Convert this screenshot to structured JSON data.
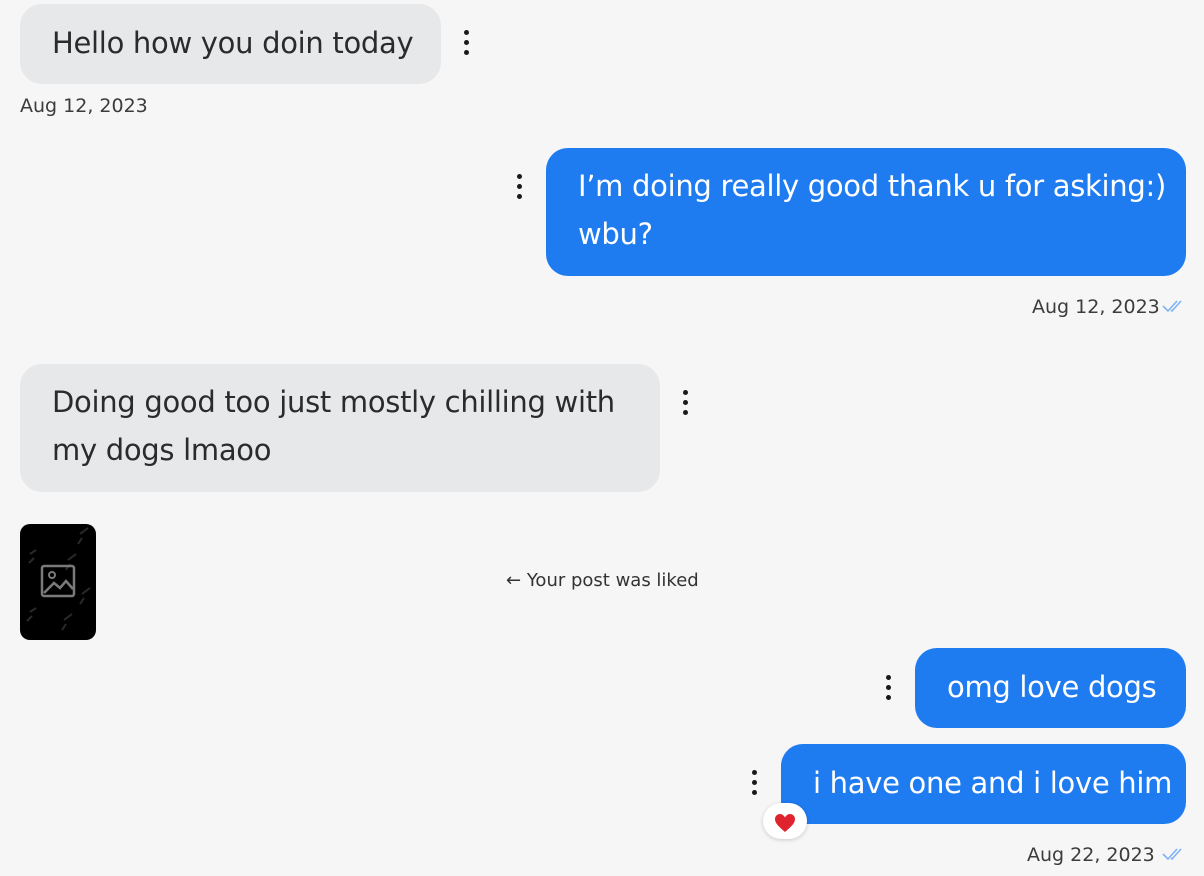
{
  "messages": [
    {
      "direction": "incoming",
      "lines": [
        "Hello how you doin today"
      ],
      "timestamp": "Aug 12, 2023"
    },
    {
      "direction": "outgoing",
      "lines": [
        "I’m doing really good thank u for asking:)",
        "wbu?"
      ],
      "timestamp": "Aug 12, 2023",
      "read_icon": "double-check-icon"
    },
    {
      "direction": "incoming",
      "lines": [
        "Doing good too just mostly chilling with",
        "my dogs lmaoo"
      ]
    },
    {
      "direction": "outgoing",
      "lines": [
        "omg love dogs"
      ]
    },
    {
      "direction": "outgoing",
      "lines": [
        "i have one and i love him"
      ],
      "timestamp": "Aug 22, 2023",
      "read_icon": "double-check-icon",
      "reaction": "❤️"
    }
  ],
  "post_notice": {
    "arrow": "←",
    "text": "Your post was liked",
    "thumbnail_icon": "image-placeholder-icon"
  },
  "colors": {
    "background": "#f6f6f6",
    "incoming_bubble": "#e6e8ea",
    "outgoing_bubble": "#1f7bf0",
    "read_check": "#7fb3f5",
    "heart": "#e0242f"
  },
  "menu_icon": "more-vertical-icon"
}
